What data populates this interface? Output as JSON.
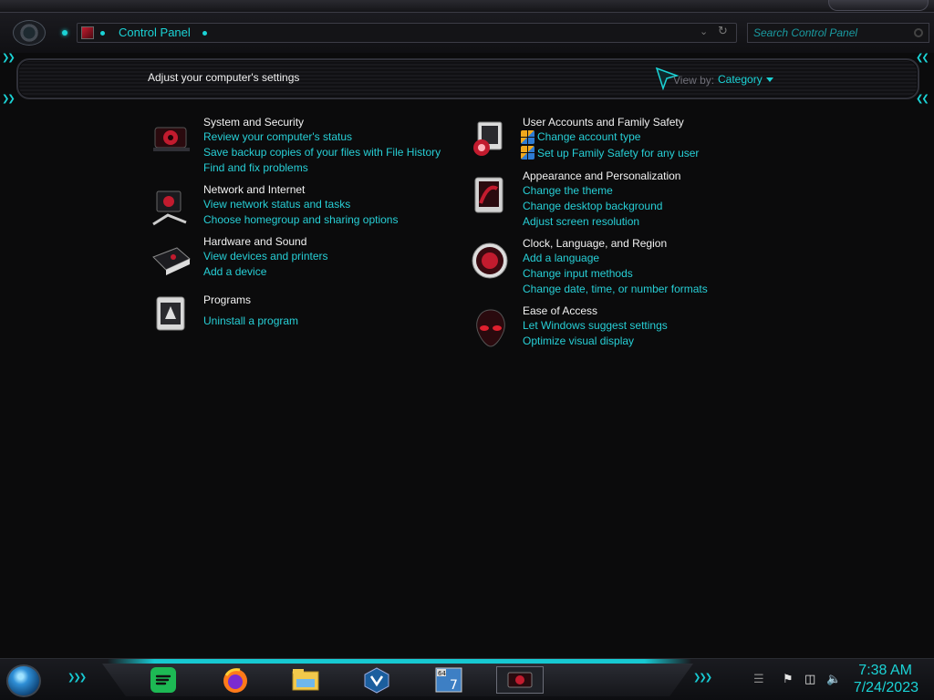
{
  "window": {
    "address": "Control Panel",
    "search_placeholder": "Search Control Panel"
  },
  "header": {
    "title": "Adjust your computer's settings",
    "view_by_label": "View by:",
    "view_by_value": "Category"
  },
  "categories": [
    {
      "title": "System and Security",
      "icon": "system-security-icon",
      "links": [
        "Review your computer's status",
        "Save backup copies of your files with File History",
        "Find and fix problems"
      ]
    },
    {
      "title": "Network and Internet",
      "icon": "network-icon",
      "links": [
        "View network status and tasks",
        "Choose homegroup and sharing options"
      ]
    },
    {
      "title": "Hardware and Sound",
      "icon": "hardware-icon",
      "links": [
        "View devices and printers",
        "Add a device"
      ]
    },
    {
      "title": "Programs",
      "icon": "programs-icon",
      "links": [
        "Uninstall a program"
      ]
    },
    {
      "title": "User Accounts and Family Safety",
      "icon": "user-accounts-icon",
      "links": [
        "Change account type",
        "Set up Family Safety for any user"
      ]
    },
    {
      "title": "Appearance and Personalization",
      "icon": "appearance-icon",
      "links": [
        "Change the theme",
        "Change desktop background",
        "Adjust screen resolution"
      ]
    },
    {
      "title": "Clock, Language, and Region",
      "icon": "clock-region-icon",
      "links": [
        "Add a language",
        "Change input methods",
        "Change date, time, or number formats"
      ]
    },
    {
      "title": "Ease of Access",
      "icon": "ease-of-access-icon",
      "links": [
        "Let Windows suggest settings",
        "Optimize visual display"
      ]
    }
  ],
  "taskbar": {
    "apps": [
      "spotify-icon",
      "firefox-icon",
      "file-explorer-icon",
      "virtualbox-icon",
      "windows7-64-icon",
      "control-panel-icon"
    ],
    "badge_64": "64",
    "badge_7": "7",
    "tray": [
      "flag-icon",
      "network-tray-icon",
      "volume-icon"
    ],
    "time": "7:38 AM",
    "date": "7/24/2023"
  },
  "colors": {
    "accent": "#1bd3d6",
    "link": "#27cfd6",
    "background": "#0b0b0c",
    "icon_red": "#c21b2e"
  }
}
